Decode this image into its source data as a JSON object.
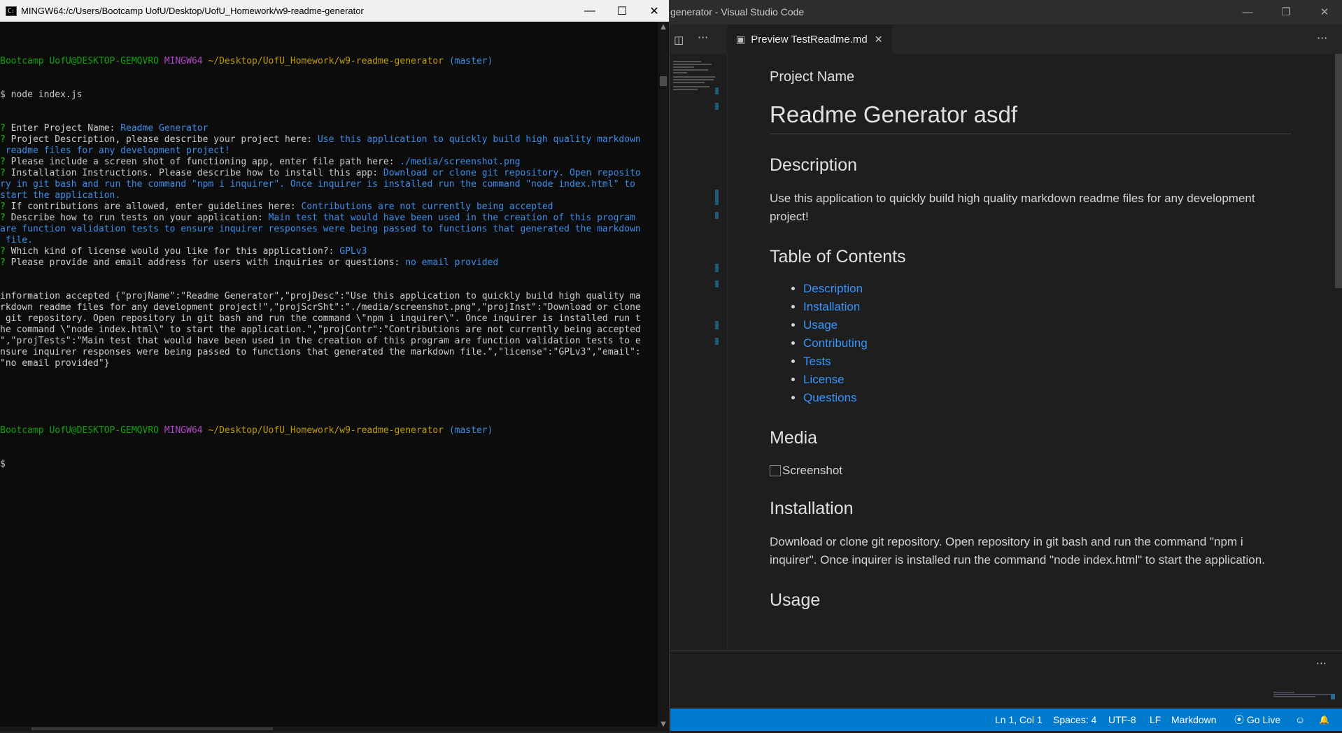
{
  "terminal": {
    "title": "MINGW64:/c/Users/Bootcamp UofU/Desktop/UofU_Homework/w9-readme-generator",
    "window_controls": {
      "minimize": "—",
      "maximize": "☐",
      "close": "✕"
    },
    "prompt": {
      "user": "Bootcamp UofU@DESKTOP-GEMQVRO",
      "shell": "MINGW64",
      "path": "~/Desktop/UofU_Homework/w9-readme-generator",
      "branch": "(master)",
      "symbol": "$"
    },
    "command": "$ node index.js",
    "qa": [
      {
        "q": "? ",
        "label": "Enter Project Name: ",
        "answer": "Readme Generator",
        "cont": []
      },
      {
        "q": "? ",
        "label": "Project Description, please describe your project here: ",
        "answer": "Use this application to quickly build high quality markdown",
        "cont": [
          " readme files for any development project!"
        ]
      },
      {
        "q": "? ",
        "label": "Please include a screen shot of functioning app, enter file path here: ",
        "answer": "./media/screenshot.png",
        "cont": []
      },
      {
        "q": "? ",
        "label": "Installation Instructions. Please describe how to install this app: ",
        "answer": "Download or clone git repository. Open reposito",
        "cont": [
          "ry in git bash and run the command \"npm i inquirer\". Once inquirer is installed run the command \"node index.html\" to",
          "start the application."
        ]
      },
      {
        "q": "? ",
        "label": "If contributions are allowed, enter guidelines here: ",
        "answer": "Contributions are not currently being accepted",
        "cont": []
      },
      {
        "q": "? ",
        "label": "Describe how to run tests on your application: ",
        "answer": "Main test that would have been used in the creation of this program",
        "cont": [
          "are function validation tests to ensure inquirer responses were being passed to functions that generated the markdown",
          " file."
        ]
      },
      {
        "q": "? ",
        "label": "Which kind of license would you like for this application?: ",
        "answer": "GPLv3",
        "cont": []
      },
      {
        "q": "? ",
        "label": "Please provide and email address for users with inquiries or questions: ",
        "answer": "no email provided",
        "cont": []
      }
    ],
    "output": [
      "information accepted {\"projName\":\"Readme Generator\",\"projDesc\":\"Use this application to quickly build high quality ma",
      "rkdown readme files for any development project!\",\"projScrSht\":\"./media/screenshot.png\",\"projInst\":\"Download or clone",
      " git repository. Open repository in git bash and run the command \\\"npm i inquirer\\\". Once inquirer is installed run t",
      "he command \\\"node index.html\\\" to start the application.\",\"projContr\":\"Contributions are not currently being accepted",
      "\",\"projTests\":\"Main test that would have been used in the creation of this program are function validation tests to e",
      "nsure inquirer responses were being passed to functions that generated the markdown file.\",\"license\":\"GPLv3\",\"email\":",
      "\"no email provided\"}"
    ],
    "scroll_arrows": {
      "up": "▲",
      "down": "▼"
    }
  },
  "vscode": {
    "title": "generator - Visual Studio Code",
    "window_controls": {
      "minimize": "—",
      "restore": "❐",
      "close": "✕"
    },
    "split_icon": "◫",
    "more": "···",
    "tab": {
      "icon": "▣",
      "label": "Preview TestReadme.md",
      "close": "✕"
    },
    "preview": {
      "project_name_label": "Project Name",
      "title": "Readme Generator asdf",
      "description_heading": "Description",
      "description_text": "Use this application to quickly build high quality markdown readme files for any development project!",
      "toc_heading": "Table of Contents",
      "toc": [
        "Description",
        "Installation",
        "Usage",
        "Contributing",
        "Tests",
        "License",
        "Questions"
      ],
      "media_heading": "Media",
      "media_alt": "Screenshot",
      "installation_heading": "Installation",
      "installation_text": "Download or clone git repository. Open repository in git bash and run the command \"npm i inquirer\". Once inquirer is installed run the command \"node index.html\" to start the application.",
      "usage_heading": "Usage"
    },
    "status": {
      "position": "Ln 1, Col 1",
      "spaces": "Spaces: 4",
      "encoding": "UTF-8",
      "eol": "LF",
      "language": "Markdown",
      "go_live_icon": "⦿",
      "go_live": "Go Live",
      "feedback_icon": "☺",
      "bell_icon": "🔔"
    },
    "accent": "#007acc",
    "link_color": "#3794ff"
  }
}
